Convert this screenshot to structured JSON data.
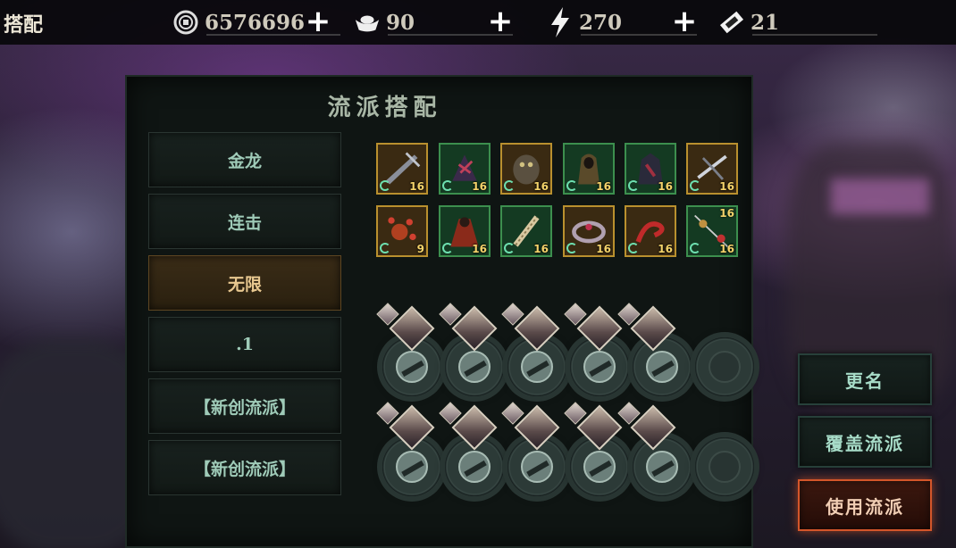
{
  "header": {
    "title": "搭配",
    "resources": [
      {
        "name": "coin",
        "icon": "coin-icon",
        "value": "6576696"
      },
      {
        "name": "ingot",
        "icon": "ingot-icon",
        "value": "90"
      },
      {
        "name": "stamina",
        "icon": "lightning-icon",
        "value": "270"
      },
      {
        "name": "ticket",
        "icon": "ticket-icon",
        "value": "21"
      }
    ],
    "add_glyph": "+"
  },
  "panel": {
    "title": "流派搭配"
  },
  "presets": [
    {
      "label": "金龙",
      "active": false
    },
    {
      "label": "连击",
      "active": false
    },
    {
      "label": "无限",
      "active": true
    },
    {
      "label": ".1",
      "active": false
    },
    {
      "label": "【新创流派】",
      "active": false
    },
    {
      "label": "【新创流派】",
      "active": false
    }
  ],
  "gear": [
    {
      "level": "16",
      "rarity": "gold",
      "icon": "blade-icon"
    },
    {
      "level": "16",
      "rarity": "green",
      "icon": "claw-armor-icon"
    },
    {
      "level": "16",
      "rarity": "gold",
      "icon": "beast-armor-icon"
    },
    {
      "level": "16",
      "rarity": "green",
      "icon": "hooded-robe-icon"
    },
    {
      "level": "16",
      "rarity": "green",
      "icon": "dark-armor-icon"
    },
    {
      "level": "16",
      "rarity": "gold",
      "icon": "crossbow-icon"
    },
    {
      "level": "9",
      "rarity": "gold",
      "icon": "flower-charm-icon"
    },
    {
      "level": "16",
      "rarity": "green",
      "icon": "red-cloak-icon"
    },
    {
      "level": "16",
      "rarity": "green",
      "icon": "bone-staff-icon"
    },
    {
      "level": "16",
      "rarity": "gold",
      "icon": "ring-icon"
    },
    {
      "level": "16",
      "rarity": "gold",
      "icon": "serpent-icon"
    },
    {
      "level": "16",
      "level_top": "16",
      "rarity": "green",
      "icon": "dual-item-icon"
    }
  ],
  "actions": {
    "rename": "更名",
    "overwrite": "覆盖流派",
    "use": "使用流派"
  },
  "colors": {
    "accent_green": "#a7dcc8",
    "accent_gold": "#e8c890",
    "accent_red": "#d4562a",
    "level_text": "#f4d36a"
  }
}
